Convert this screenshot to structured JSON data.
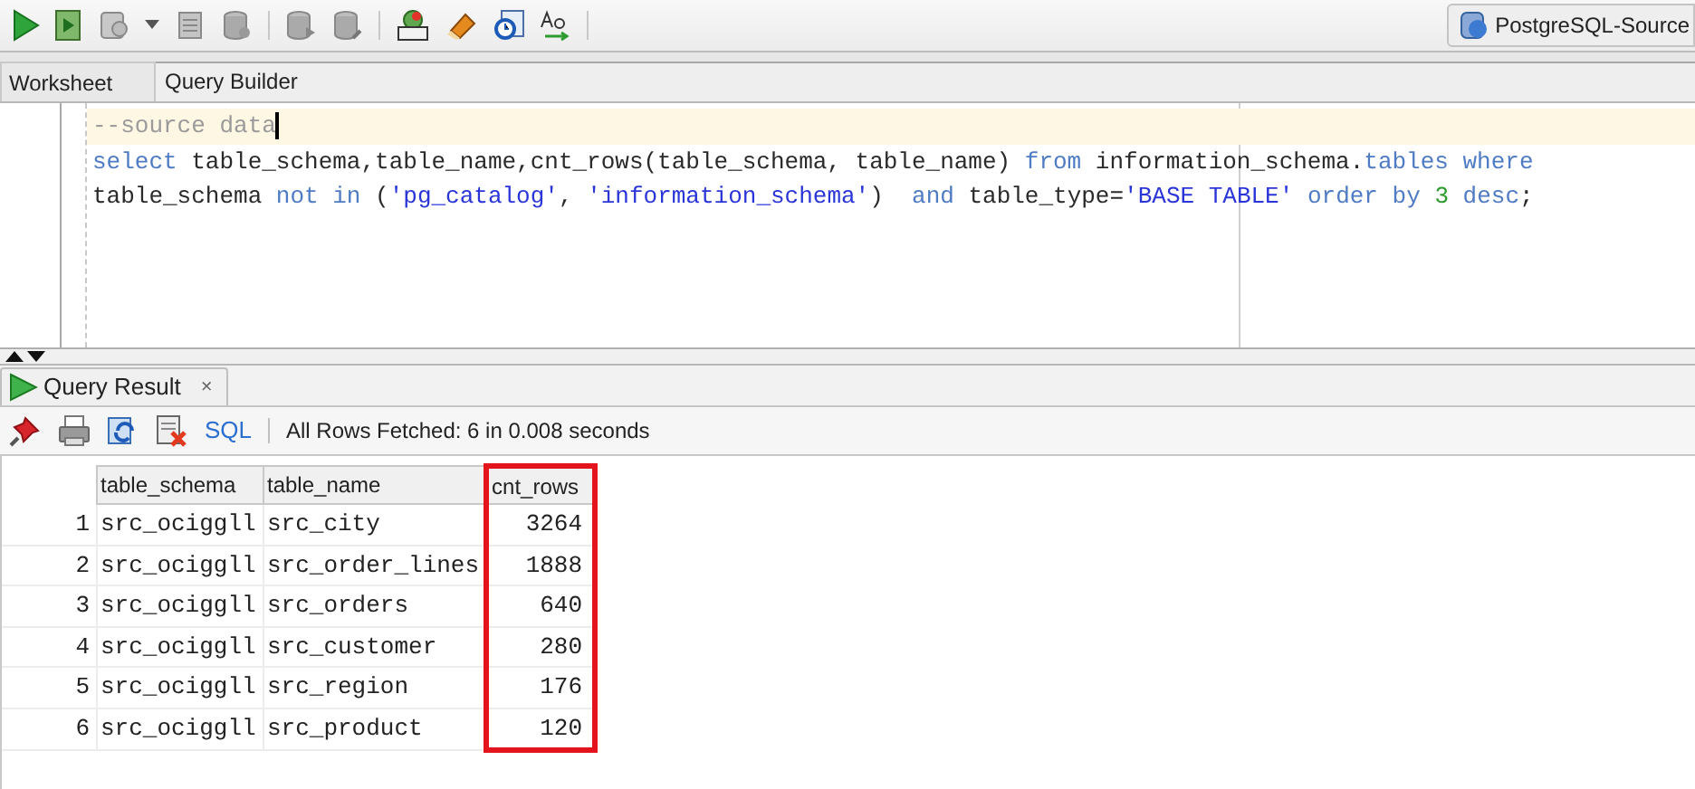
{
  "connection": {
    "label": "PostgreSQL-Source"
  },
  "editor_tabs": [
    {
      "label": "Worksheet",
      "selected": true
    },
    {
      "label": "Query Builder",
      "selected": false
    }
  ],
  "code_lines": [
    {
      "current": true,
      "tokens": [
        {
          "kind": "comment",
          "text": "--source data"
        }
      ]
    },
    {
      "current": false,
      "tokens": [
        {
          "kind": "keyword",
          "text": "select"
        },
        {
          "kind": "plain",
          "text": " table_schema,table_name,cnt_rows(table_schema, table_name) "
        },
        {
          "kind": "keyword",
          "text": "from"
        },
        {
          "kind": "plain",
          "text": " information_schema."
        },
        {
          "kind": "keyword",
          "text": "tables where"
        }
      ]
    },
    {
      "current": false,
      "tokens": [
        {
          "kind": "plain",
          "text": "table_schema "
        },
        {
          "kind": "keyword",
          "text": "not in"
        },
        {
          "kind": "plain",
          "text": " ("
        },
        {
          "kind": "string",
          "text": "'pg_catalog'"
        },
        {
          "kind": "plain",
          "text": ", "
        },
        {
          "kind": "string",
          "text": "'information_schema'"
        },
        {
          "kind": "plain",
          "text": ")  "
        },
        {
          "kind": "keyword",
          "text": "and"
        },
        {
          "kind": "plain",
          "text": " table_type="
        },
        {
          "kind": "string",
          "text": "'BASE TABLE'"
        },
        {
          "kind": "keyword",
          "text": " order by "
        },
        {
          "kind": "number",
          "text": "3"
        },
        {
          "kind": "keyword",
          "text": " desc"
        },
        {
          "kind": "plain",
          "text": ";"
        }
      ]
    }
  ],
  "result_tab": {
    "label": "Query Result",
    "close": "×"
  },
  "result_toolbar": {
    "sql_link": "SQL",
    "status": "All Rows Fetched: 6 in 0.008 seconds"
  },
  "grid": {
    "columns": [
      {
        "label": "table_schema",
        "highlighted": false
      },
      {
        "label": "table_name",
        "highlighted": false
      },
      {
        "label": "cnt_rows",
        "highlighted": true
      }
    ],
    "rows": [
      {
        "number": "1",
        "cells": [
          "src_ociggll",
          "src_city",
          "3264"
        ]
      },
      {
        "number": "2",
        "cells": [
          "src_ociggll",
          "src_order_lines",
          "1888"
        ]
      },
      {
        "number": "3",
        "cells": [
          "src_ociggll",
          "src_orders",
          "640"
        ]
      },
      {
        "number": "4",
        "cells": [
          "src_ociggll",
          "src_customer",
          "280"
        ]
      },
      {
        "number": "5",
        "cells": [
          "src_ociggll",
          "src_region",
          "176"
        ]
      },
      {
        "number": "6",
        "cells": [
          "src_ociggll",
          "src_product",
          "120"
        ]
      }
    ]
  }
}
